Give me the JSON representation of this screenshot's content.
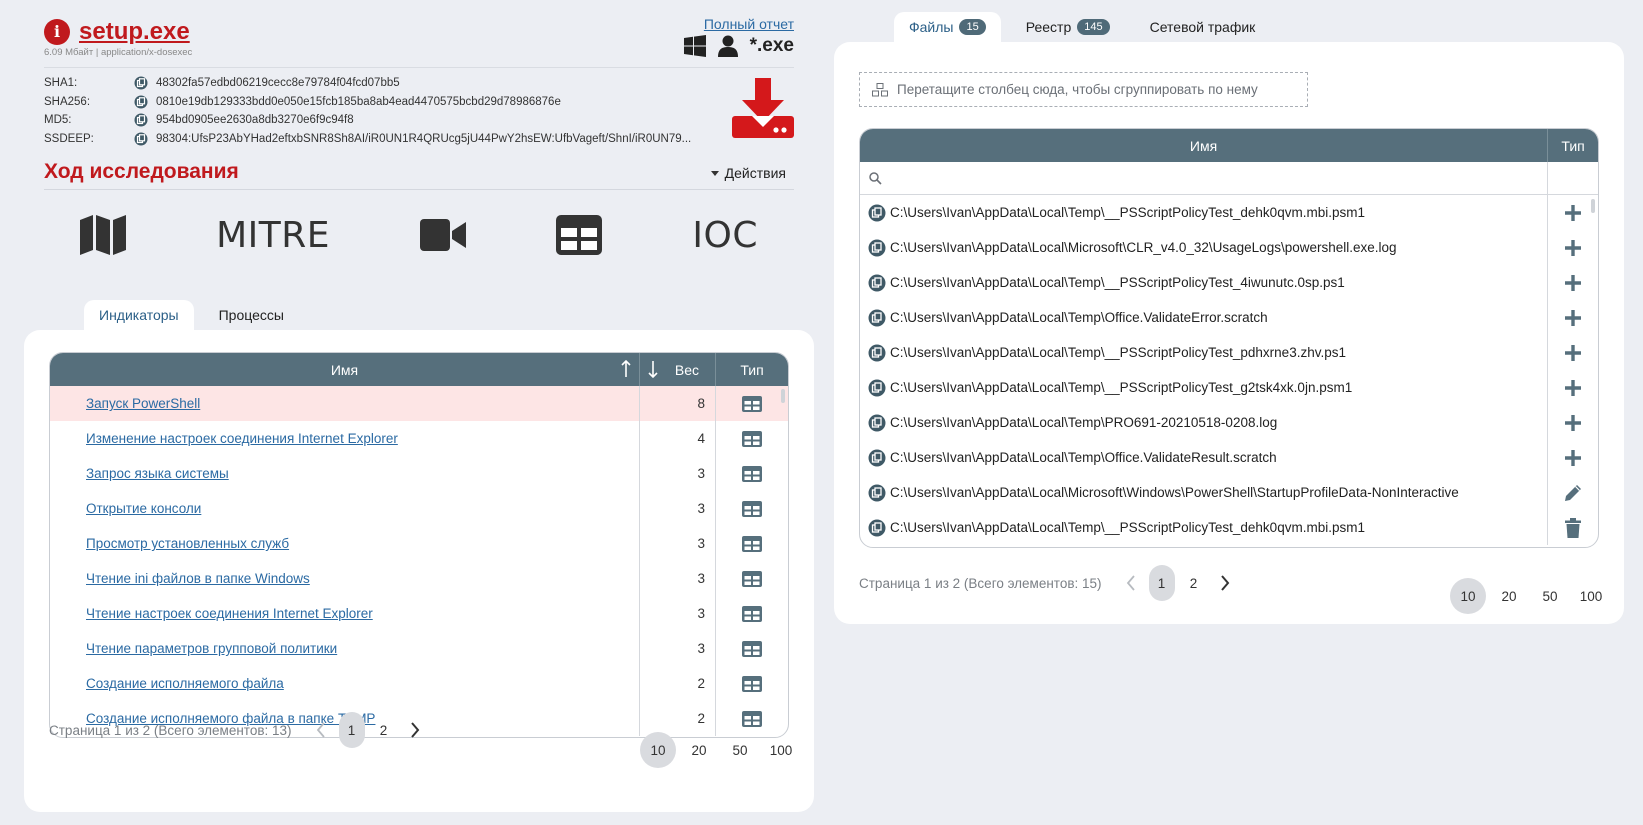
{
  "header": {
    "file_name": "setup.exe",
    "meta": "6.09 Мбайт | application/x-dosexec",
    "full_report_link": "Полный отчет",
    "extension": "*.exe",
    "icons": [
      "info-icon",
      "windows-icon",
      "user-icon",
      "download-icon"
    ],
    "hashes": [
      {
        "label": "SHA1:",
        "value": "48302fa57edbd06219cecc8e79784f04fcd07bb5"
      },
      {
        "label": "SHA256:",
        "value": "0810e19db129333bdd0e050e15fcb185ba8ab4ead4470575bcbd29d78986876e"
      },
      {
        "label": "MD5:",
        "value": "954bd0905ee2630a8db3270e6f9c94f8"
      },
      {
        "label": "SSDEEP:",
        "value": "98304:UfsP23AbYHad2eftxbSNR8Sh8AI/iR0UN1R4QRUcg5jU44PwY2hsEW:UfbVageft/ShnI/iR0UN79..."
      }
    ]
  },
  "investigation": {
    "title": "Ход исследования",
    "actions_label": "Действия",
    "tools": [
      {
        "type": "icon",
        "icon": "map-icon"
      },
      {
        "type": "text",
        "label": "MITRE"
      },
      {
        "type": "icon",
        "icon": "video-camera-icon"
      },
      {
        "type": "icon",
        "icon": "table-icon"
      },
      {
        "type": "text",
        "label": "IOC"
      }
    ]
  },
  "left_tabs": [
    {
      "label": "Индикаторы",
      "active": true
    },
    {
      "label": "Процессы",
      "active": false
    }
  ],
  "indicators": {
    "columns": {
      "name": "Имя",
      "weight": "Вес",
      "type": "Тип"
    },
    "rows": [
      {
        "name": "Запуск PowerShell",
        "weight": "8",
        "highlight": true
      },
      {
        "name": "Изменение настроек соединения Internet Explorer",
        "weight": "4"
      },
      {
        "name": "Запрос языка системы",
        "weight": "3"
      },
      {
        "name": "Открытие консоли",
        "weight": "3"
      },
      {
        "name": "Просмотр установленных служб",
        "weight": "3"
      },
      {
        "name": "Чтение ini файлов в папке Windows",
        "weight": "3"
      },
      {
        "name": "Чтение настроек соединения Internet Explorer",
        "weight": "3"
      },
      {
        "name": "Чтение параметров групповой политики",
        "weight": "3"
      },
      {
        "name": "Создание исполняемого файла",
        "weight": "2"
      },
      {
        "name": "Создание исполняемого файла в папке TEMP",
        "weight": "2"
      }
    ],
    "pager": {
      "summary": "Страница 1 из 2 (Всего элементов: 13)",
      "pages": [
        "1",
        "2"
      ],
      "sizes": [
        "10",
        "20",
        "50",
        "100"
      ]
    }
  },
  "right_tabs": [
    {
      "label": "Файлы",
      "badge": "15",
      "active": true
    },
    {
      "label": "Реестр",
      "badge": "145",
      "active": false
    },
    {
      "label": "Сетевой трафик",
      "badge": "",
      "active": false
    }
  ],
  "files": {
    "group_hint": "Перетащите столбец сюда, чтобы сгруппировать по нему",
    "columns": {
      "name": "Имя",
      "type": "Тип"
    },
    "rows": [
      {
        "path": "C:\\Users\\Ivan\\AppData\\Local\\Temp\\__PSScriptPolicyTest_dehk0qvm.mbi.psm1",
        "action": "plus-icon"
      },
      {
        "path": "C:\\Users\\Ivan\\AppData\\Local\\Microsoft\\CLR_v4.0_32\\UsageLogs\\powershell.exe.log",
        "action": "plus-icon"
      },
      {
        "path": "C:\\Users\\Ivan\\AppData\\Local\\Temp\\__PSScriptPolicyTest_4iwunutc.0sp.ps1",
        "action": "plus-icon"
      },
      {
        "path": "C:\\Users\\Ivan\\AppData\\Local\\Temp\\Office.ValidateError.scratch",
        "action": "plus-icon"
      },
      {
        "path": "C:\\Users\\Ivan\\AppData\\Local\\Temp\\__PSScriptPolicyTest_pdhxrne3.zhv.ps1",
        "action": "plus-icon"
      },
      {
        "path": "C:\\Users\\Ivan\\AppData\\Local\\Temp\\__PSScriptPolicyTest_g2tsk4xk.0jn.psm1",
        "action": "plus-icon"
      },
      {
        "path": "C:\\Users\\Ivan\\AppData\\Local\\Temp\\PRO691-20210518-0208.log",
        "action": "plus-icon"
      },
      {
        "path": "C:\\Users\\Ivan\\AppData\\Local\\Temp\\Office.ValidateResult.scratch",
        "action": "plus-icon"
      },
      {
        "path": "C:\\Users\\Ivan\\AppData\\Local\\Microsoft\\Windows\\PowerShell\\StartupProfileData-NonInteractive",
        "action": "pencil-icon"
      },
      {
        "path": "C:\\Users\\Ivan\\AppData\\Local\\Temp\\__PSScriptPolicyTest_dehk0qvm.mbi.psm1",
        "action": "trash-icon"
      }
    ],
    "pager": {
      "summary": "Страница 1 из 2 (Всего элементов: 15)",
      "pages": [
        "1",
        "2"
      ],
      "sizes": [
        "10",
        "20",
        "50",
        "100"
      ]
    }
  },
  "colors": {
    "accent_red": "#c0191d",
    "grid_header": "#566f7c",
    "link": "#2b6aa3",
    "highlight_row": "#fde5e5"
  }
}
